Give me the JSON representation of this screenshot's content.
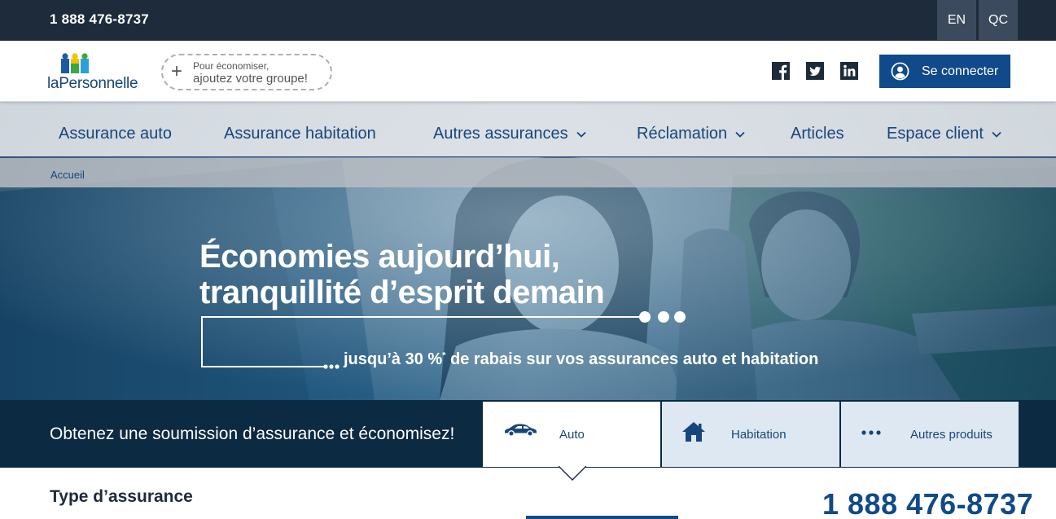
{
  "topbar": {
    "phone": "1 888 476-8737",
    "languages": [
      {
        "label": "EN"
      },
      {
        "label": "QC"
      }
    ]
  },
  "header": {
    "logo_text": "laPersonnelle",
    "group_button": {
      "line1": "Pour économiser,",
      "line2": "ajoutez votre groupe!"
    },
    "social": [
      "facebook-icon",
      "twitter-icon",
      "linkedin-icon"
    ],
    "login_label": "Se connecter"
  },
  "nav": {
    "items": [
      {
        "label": "Assurance auto",
        "dropdown": false
      },
      {
        "label": "Assurance habitation",
        "dropdown": false
      },
      {
        "label": "Autres assurances",
        "dropdown": true
      },
      {
        "label": "Réclamation",
        "dropdown": true
      },
      {
        "label": "Articles",
        "dropdown": false
      },
      {
        "label": "Espace client",
        "dropdown": true
      }
    ]
  },
  "breadcrumb": {
    "home": "Accueil"
  },
  "hero": {
    "headline_line1": "Économies aujourd’hui,",
    "headline_line2": "tranquillité d’esprit demain",
    "subline_prefix": "jusqu’à 30 %",
    "subline_sup": "*",
    "subline_suffix": " de rabais sur vos assurances auto et habitation"
  },
  "quote_band": {
    "text": "Obtenez une soumission d’assurance et économisez!",
    "tabs": [
      {
        "label": "Auto",
        "icon": "car-icon",
        "active": true
      },
      {
        "label": "Habitation",
        "icon": "house-icon",
        "active": false
      },
      {
        "label": "Autres produits",
        "icon": "more-dots-icon",
        "active": false
      }
    ]
  },
  "bottom": {
    "type_title": "Type d’assurance",
    "phone": "1 888 476-8737"
  },
  "colors": {
    "dark_navy": "#1e2b3b",
    "brand_blue": "#104a8a",
    "link_blue": "#17467a",
    "band_navy": "#0c2a42",
    "tab_light": "#dde8f3"
  }
}
